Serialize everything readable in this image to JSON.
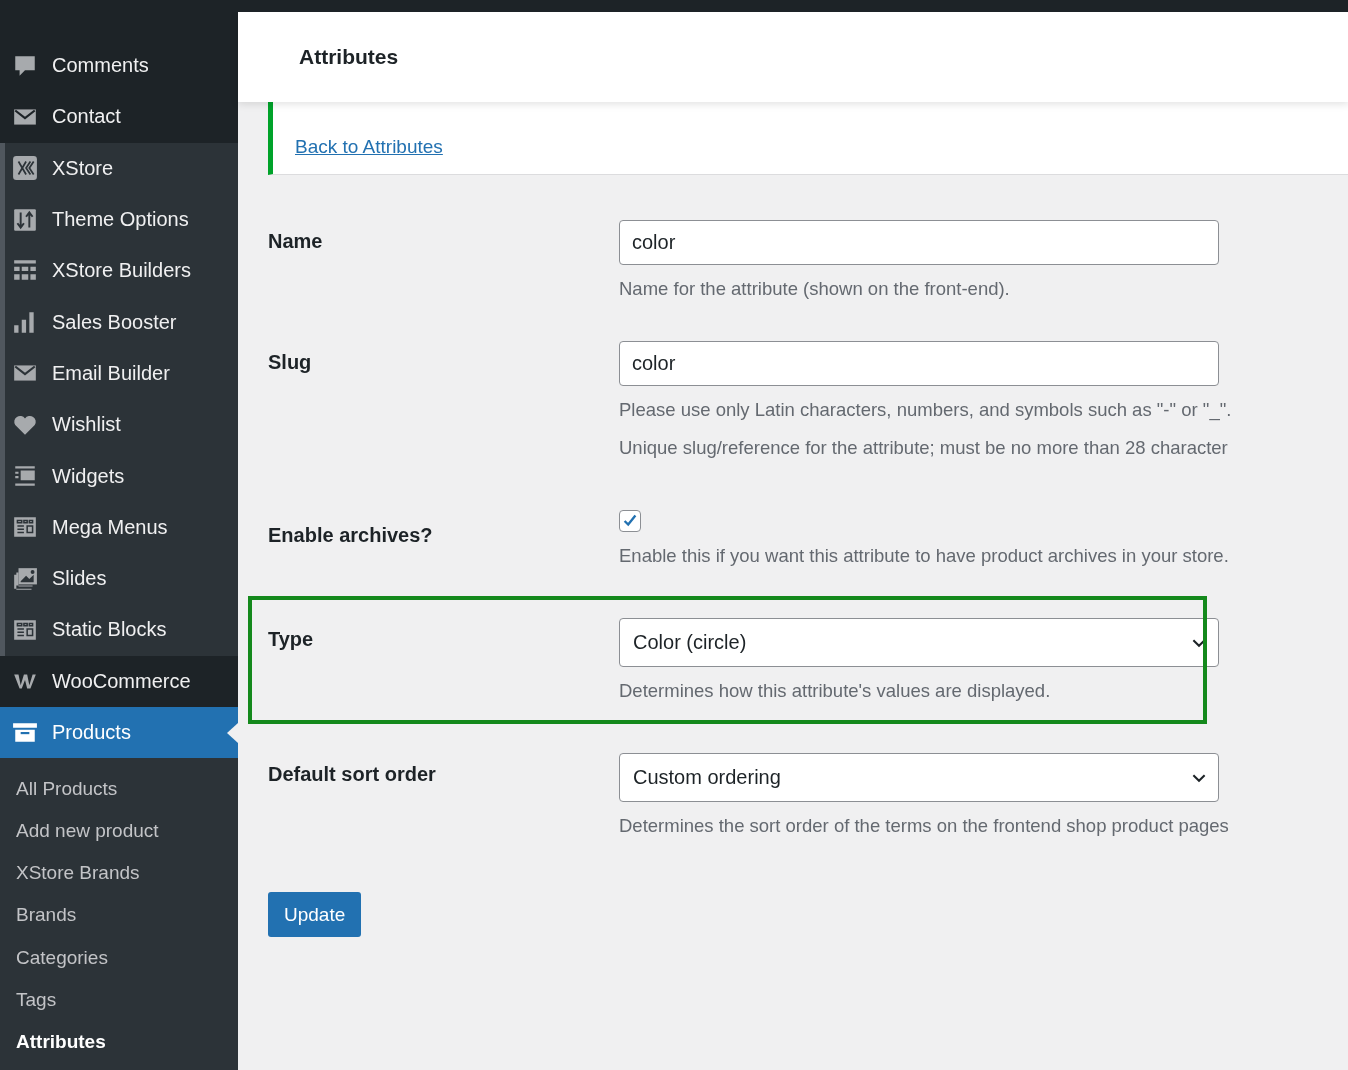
{
  "sidebar": {
    "groups": [
      {
        "kind": "dark",
        "items": [
          {
            "label": "Comments"
          },
          {
            "label": "Contact"
          }
        ]
      },
      {
        "kind": "plugin",
        "items": [
          {
            "label": "XStore"
          },
          {
            "label": "Theme Options"
          },
          {
            "label": "XStore Builders"
          },
          {
            "label": "Sales Booster"
          },
          {
            "label": "Email Builder"
          },
          {
            "label": "Wishlist"
          },
          {
            "label": "Widgets"
          },
          {
            "label": "Mega Menus"
          },
          {
            "label": "Slides"
          },
          {
            "label": "Static Blocks"
          }
        ]
      },
      {
        "kind": "dark",
        "items": [
          {
            "label": "WooCommerce"
          }
        ]
      }
    ],
    "current": {
      "label": "Products",
      "selected": true
    },
    "submenu": [
      {
        "label": "All Products",
        "selected": false
      },
      {
        "label": "Add new product",
        "selected": false
      },
      {
        "label": "XStore Brands",
        "selected": false
      },
      {
        "label": "Brands",
        "selected": false
      },
      {
        "label": "Categories",
        "selected": false
      },
      {
        "label": "Tags",
        "selected": false
      },
      {
        "label": "Attributes",
        "selected": true
      }
    ]
  },
  "header": {
    "title": "Attributes"
  },
  "notice": {
    "link": "Back to Attributes"
  },
  "fields": [
    {
      "kind": "text",
      "label": "Name",
      "value": "color",
      "descriptions": [
        "Name for the attribute (shown on the front-end)."
      ],
      "highlighted": false
    },
    {
      "kind": "text",
      "label": "Slug",
      "value": "color",
      "descriptions": [
        "Please use only Latin characters, numbers, and symbols such as \"-\" or \"_\".",
        "Unique slug/reference for the attribute; must be no more than 28 character"
      ],
      "highlighted": false
    },
    {
      "kind": "checkbox",
      "label": "Enable archives?",
      "checked": true,
      "descriptions": [
        "Enable this if you want this attribute to have product archives in your store."
      ],
      "highlighted": false
    },
    {
      "kind": "select",
      "label": "Type",
      "value": "Color (circle)",
      "descriptions": [
        "Determines how this attribute's values are displayed."
      ],
      "highlighted": true
    },
    {
      "kind": "select",
      "label": "Default sort order",
      "value": "Custom ordering",
      "descriptions": [
        "Determines the sort order of the terms on the frontend shop product pages"
      ],
      "highlighted": false
    }
  ],
  "submit": {
    "label": "Update"
  }
}
